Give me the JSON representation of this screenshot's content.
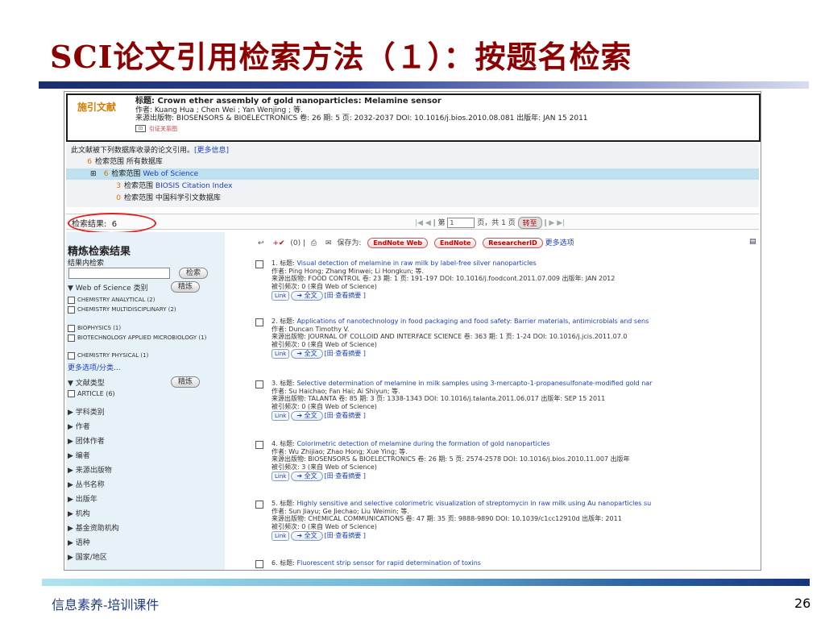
{
  "slide": {
    "title": "SCI论文引用检索方法（１）：按题名检索",
    "footer_left": "信息素养-培训课件",
    "page_number": "26"
  },
  "citing": {
    "tag": "施引文献",
    "title_line": "标题: Crown ether assembly of gold nanoparticles: Melamine sensor",
    "author_line": "作者: Kuang Hua ; Chen Wei ; Yan Wenjing ; 等.",
    "source_line": "来源出版物: BIOSENSORS & BIOELECTRONICS  卷: 26  期: 5  页: 2032-2037   DOI: 10.1016/j.bios.2010.08.081   出版年: JAN 15 2011",
    "tool_label": "引证关系图"
  },
  "databases": {
    "intro": "此文献被下列数据库收录的论文引用。",
    "more_link": "[更多信息]",
    "rows": [
      {
        "num": "6",
        "label": "检索范围",
        "name": "所有数据库"
      },
      {
        "num": "6",
        "label": "检索范围",
        "name": "Web of Science"
      },
      {
        "num": "3",
        "label": "检索范围",
        "name": "BIOSIS Citation Index"
      },
      {
        "num": "0",
        "label": "检索范围",
        "name": "中国科学引文数据库"
      }
    ]
  },
  "results": {
    "label": "检索结果:",
    "count": "6",
    "pager_prefix": "第",
    "page_value": "1",
    "pager_suffix": "页，共 1 页",
    "go_label": "转至"
  },
  "sidebar": {
    "heading": "精炼检索结果",
    "sub": "结果内检索",
    "search_btn": "检索",
    "category_label": "Web of Science 类别",
    "refine_btn": "精炼",
    "categories": [
      "CHEMISTRY ANALYTICAL (2)",
      "CHEMISTRY MULTIDISCIPLINARY (2)",
      "BIOPHYSICS (1)",
      "BIOTECHNOLOGY APPLIED MICROBIOLOGY (1)",
      "CHEMISTRY PHYSICAL (1)"
    ],
    "more_options": "更多选项/分类...",
    "doctype_label": "文献类型",
    "doctype_refine": "精炼",
    "doctype_item": "ARTICLE (6)",
    "facets": [
      "学科类别",
      "作者",
      "团体作者",
      "编者",
      "来源出版物",
      "丛书名称",
      "出版年",
      "机构",
      "基金资助机构",
      "语种",
      "国家/地区"
    ]
  },
  "toolbar": {
    "count": "(0)",
    "save_as": "保存为:",
    "endnote_web": "EndNote Web",
    "endnote": "EndNote",
    "researcherid": "ResearcherID",
    "more": "更多选项"
  },
  "records": [
    {
      "num": "1.",
      "title": "Visual detection of melamine in raw milk by label-free silver nanoparticles",
      "author": "作者: Ping Hong; Zhang Minwei; Li Hongkun; 等.",
      "source": "来源出版物: FOOD CONTROL  卷: 23  期: 1  页: 191-197   DOI: 10.1016/j.foodcont.2011.07.009  出版年: JAN 2012",
      "cited": "被引频次: 0 (来自 Web of Science)"
    },
    {
      "num": "2.",
      "title": "Applications of nanotechnology in food packaging and food safety: Barrier materials, antimicrobials and sens",
      "author": "作者: Duncan Timothy V.",
      "source": "来源出版物: JOURNAL OF COLLOID AND INTERFACE SCIENCE  卷: 363  期: 1  页: 1-24   DOI: 10.1016/j.jcis.2011.07.0",
      "cited": "被引频次: 0 (来自 Web of Science)"
    },
    {
      "num": "3.",
      "title": "Selective determination of melamine in milk samples using 3-mercapto-1-propanesulfonate-modified gold nar",
      "author": "作者: Su Haichao; Fan Hai; Ai Shiyun; 等.",
      "source": "来源出版物: TALANTA  卷: 85  期: 3  页: 1338-1343   DOI: 10.1016/j.talanta.2011.06.017  出版年: SEP 15 2011",
      "cited": "被引频次: 0 (来自 Web of Science)"
    },
    {
      "num": "4.",
      "title": "Colorimetric detection of melamine during the formation of gold nanoparticles",
      "author": "作者: Wu Zhijiao; Zhao Hong; Xue Ying; 等.",
      "source": "来源出版物: BIOSENSORS & BIOELECTRONICS  卷: 26  期: 5  页: 2574-2578   DOI: 10.1016/j.bios.2010.11.007  出版年",
      "cited": "被引频次: 3 (来自 Web of Science)"
    },
    {
      "num": "5.",
      "title": "Highly sensitive and selective colorimetric visualization of streptomycin in raw milk using Au nanoparticles su",
      "author": "作者: Sun Jiayu; Ge Jiechao; Liu Weimin; 等.",
      "source": "来源出版物: CHEMICAL COMMUNICATIONS  卷: 47  期: 35  页: 9888-9890   DOI: 10.1039/c1cc12910d  出版年: 2011",
      "cited": "被引频次: 0 (来自 Web of Science)"
    },
    {
      "num": "6.",
      "title": "Fluorescent strip sensor for rapid determination of toxins",
      "author": "",
      "source": "",
      "cited": ""
    }
  ],
  "record_actions": {
    "link": "Link",
    "fulltext": "全文",
    "abstract": "[田·查看摘要 ]",
    "title_prefix": "标题: "
  }
}
